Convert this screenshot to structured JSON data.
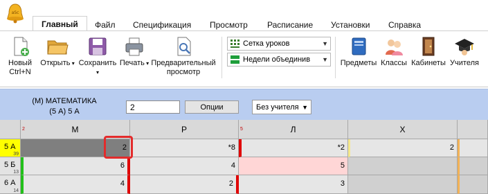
{
  "ribbon": {
    "tabs": [
      "Главный",
      "Файл",
      "Спецификация",
      "Просмотр",
      "Расписание",
      "Установки",
      "Справка"
    ],
    "active_tab": "Главный",
    "buttons": {
      "new": "Новый\nCtrl+N",
      "open": "Открыть",
      "save": "Сохранить",
      "print": "Печать",
      "preview": "Предварительный\nпросмотр",
      "subjects": "Предметы",
      "classes": "Классы",
      "rooms": "Кабинеты",
      "teachers": "Учителя"
    },
    "combos": {
      "view": "Сетка уроков",
      "weeks": "Недели объединив"
    }
  },
  "panel": {
    "subject_line1": "(М) МАТЕМАТИКА",
    "subject_line2": "(5 А) 5 А",
    "count_value": "2",
    "options_label": "Опции",
    "teacher_select": "Без учителя"
  },
  "grid": {
    "columns": [
      {
        "label": "М",
        "corner": "2"
      },
      {
        "label": "Р",
        "corner": ""
      },
      {
        "label": "Л",
        "corner": "5"
      },
      {
        "label": "Х",
        "corner": ""
      }
    ],
    "rows": [
      {
        "name": "5 А",
        "small": "39",
        "cells": [
          "2",
          "*8",
          "*2",
          "2"
        ]
      },
      {
        "name": "5 Б",
        "small": "13",
        "cells": [
          "6",
          "4",
          "5",
          ""
        ]
      },
      {
        "name": "6 А",
        "small": "14",
        "cells": [
          "4",
          "2",
          "3",
          ""
        ]
      }
    ]
  },
  "colors": {
    "panel_bg": "#b9cdf0",
    "selected_row_header": "#ffff00",
    "selected_cell": "#7f7f7f",
    "pink_cell": "#ffd6d6",
    "red_marker": "#e00000",
    "green_marker": "#22c01a",
    "yellow_marker": "#f5e88c",
    "orange_marker": "#f3b256"
  }
}
